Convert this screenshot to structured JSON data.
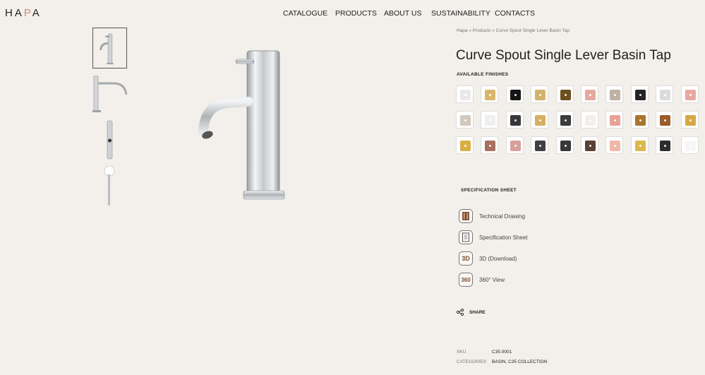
{
  "logo": {
    "before": "H",
    "mid1": "A",
    "accent": "P",
    "after": "A"
  },
  "nav": [
    "CATALOGUE",
    "PRODUCTS",
    "ABOUT US",
    "SUSTAINABILITY",
    "CONTACTS"
  ],
  "breadcrumb": {
    "home": "Hapa",
    "sep1": " » ",
    "products": "Products",
    "sep2": " » ",
    "current": "Curve Spout Single Lever Basin Tap"
  },
  "product": {
    "title": "Curve Spout Single Lever Basin Tap"
  },
  "finishes": {
    "label": "AVAILABLE FINISHES",
    "colors": [
      "#e9e9ea",
      "#d9b66a",
      "#151515",
      "#d2b36b",
      "#6e4f1f",
      "#e6a9a1",
      "#bdb2a5",
      "#252525",
      "#dcdcdc",
      "#e8a8a0",
      "#d2c8bd",
      "#f1efed",
      "#373737",
      "#d6b060",
      "#3b3b3d",
      "#f2efec",
      "#e8a194",
      "#a9762e",
      "#9b5b2a",
      "#d6a945",
      "#d8af45",
      "#a86f5f",
      "#d8a09b",
      "#404043",
      "#383838",
      "#5a4134",
      "#f1b7a8",
      "#dcb84d",
      "#2d2d2d",
      "#f6f6f6"
    ]
  },
  "spec": {
    "heading": "SPECIFICATION SHEET",
    "items": [
      {
        "label": "Technical Drawing",
        "icon": "technical-drawing-icon"
      },
      {
        "label": "Specification Sheet",
        "icon": "document-icon"
      },
      {
        "label": "3D (Download)",
        "icon": "3d-icon",
        "icon_text": "3D"
      },
      {
        "label": "360° View",
        "icon": "360-icon",
        "icon_text": "360"
      }
    ]
  },
  "share": {
    "label": "SHARE"
  },
  "meta": {
    "sku_label": "SKU",
    "sku": "C35.0001",
    "categories_label": "CATEGORIES",
    "categories": "BASIN, C35 COLLECTION"
  }
}
